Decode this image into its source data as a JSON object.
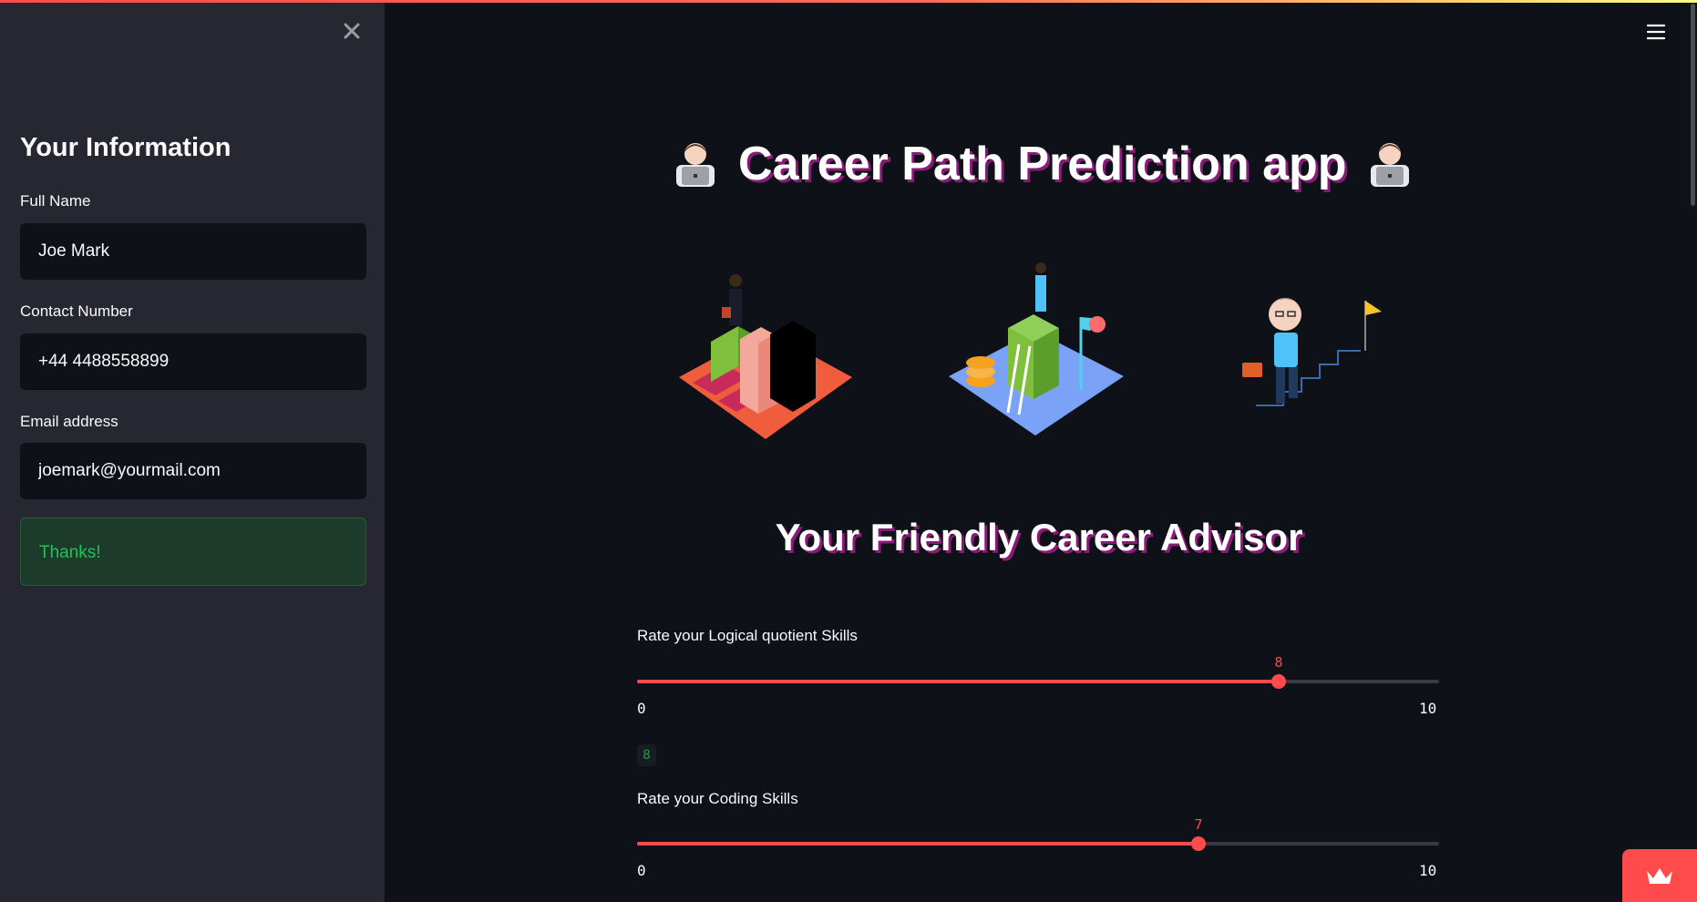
{
  "sidebar": {
    "close_icon": "close-icon",
    "title": "Your Information",
    "fields": [
      {
        "label": "Full Name",
        "value": "Joe Mark"
      },
      {
        "label": "Contact Number",
        "value": "+44 4488558899"
      },
      {
        "label": "Email address",
        "value": "joemark@yourmail.com"
      }
    ],
    "success_message": "Thanks!"
  },
  "header": {
    "menu_icon": "hamburger-menu-icon"
  },
  "main": {
    "title": "Career Path Prediction app",
    "title_emoji": "technologist-emoji",
    "illustrations": [
      "business-growth-illustration",
      "goal-achievement-illustration",
      "career-steps-illustration"
    ],
    "subtitle": "Your Friendly Career Advisor",
    "sliders": [
      {
        "label": "Rate your Logical quotient Skills",
        "value": 8,
        "min": 0,
        "max": 10,
        "min_label": "0",
        "max_label": "10",
        "value_label": "8"
      },
      {
        "label": "Rate your Coding Skills",
        "value": 7,
        "min": 0,
        "max": 10,
        "min_label": "0",
        "max_label": "10",
        "value_label": "7"
      }
    ],
    "echo_value": "8"
  },
  "colors": {
    "accent": "#ff4b4b",
    "background": "#0e1117",
    "sidebar": "#262730",
    "success_text": "#21c354"
  },
  "badge_icon": "crown-icon"
}
